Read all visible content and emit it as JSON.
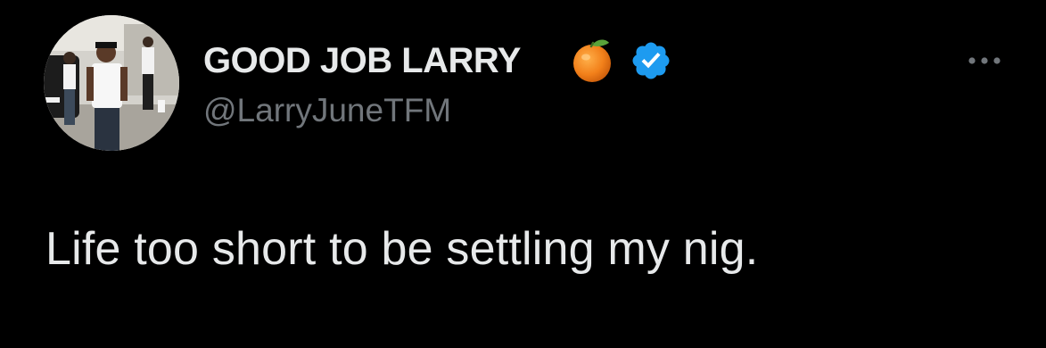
{
  "tweet": {
    "author": {
      "display_name": "GOOD JOB LARRY",
      "handle": "@LarryJuneTFM",
      "name_emoji": "orange-icon",
      "verified_badge": "verified-badge-icon",
      "verified_color": "#1d9bf0"
    },
    "text": "Life too short to be settling my nig.",
    "more_menu_icon": "more-options-icon"
  },
  "colors": {
    "background": "#000000",
    "primary_text": "#e7e9ea",
    "secondary_text": "#71767b"
  }
}
